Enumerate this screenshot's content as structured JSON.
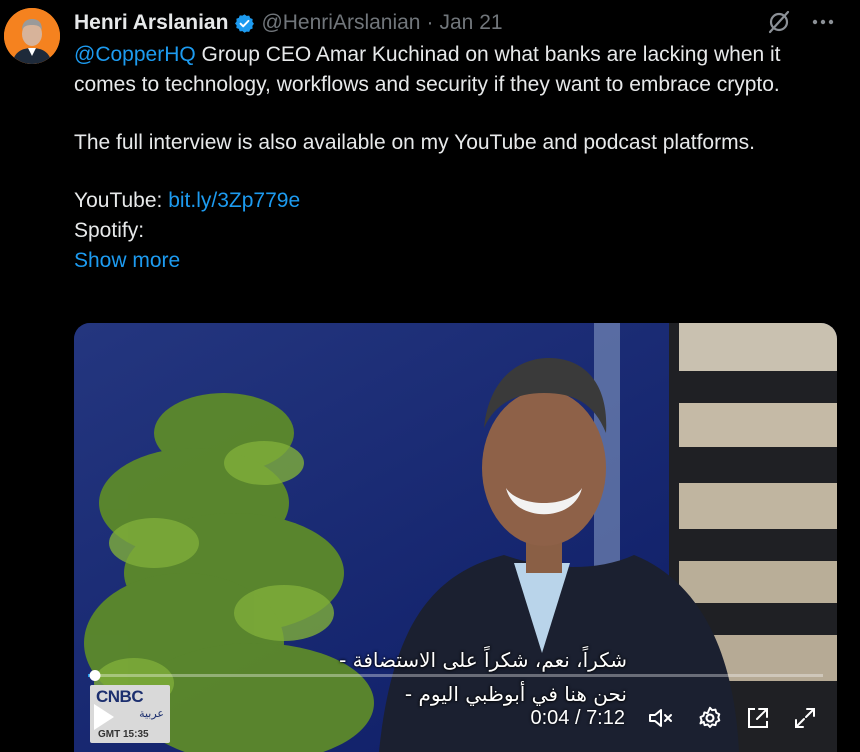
{
  "tweet": {
    "author_name": "Henri Arslanian",
    "handle": "@HenriArslanian",
    "separator": "·",
    "date": "Jan 21",
    "mention": "@CopperHQ",
    "line1_rest": " Group CEO Amar Kuchinad on what banks are lacking when it comes to technology, workflows and security if they want to embrace crypto.",
    "line2": "The full interview is also available on my YouTube and podcast platforms.",
    "youtube_label": "YouTube: ",
    "youtube_link": "bit.ly/3Zp779e",
    "spotify_label": "Spotify:",
    "show_more": "Show more"
  },
  "icons": {
    "verified": "verified-badge-icon",
    "grok": "grok-icon",
    "more": "more-icon"
  },
  "video": {
    "subtitle_line1": "- شكراً، نعم، شكراً على الاستضافة",
    "subtitle_line2": "- نحن هنا في أبوظبي اليوم",
    "channel_logo": "CNBC",
    "channel_logo_ar": "عربية",
    "channel_time": "GMT 15:35",
    "current_time": "0:04",
    "duration": "7:12",
    "time_separator": " / ",
    "progress_fraction": 0.009
  },
  "colors": {
    "accent": "#1d9bf0",
    "background": "#000000",
    "text": "#e7e9ea",
    "muted": "#71767b",
    "avatar_bg": "#f5821f"
  }
}
